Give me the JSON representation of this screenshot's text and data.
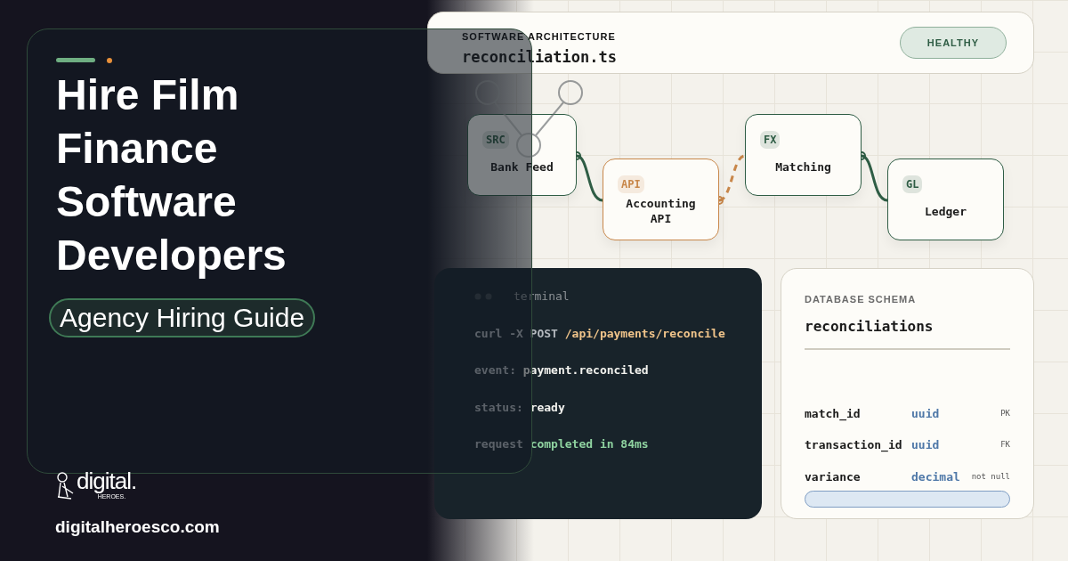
{
  "overlay": {
    "title_lines": [
      "Hire Film",
      "Finance",
      "Software",
      "Developers"
    ],
    "subtitle": "Agency Hiring Guide"
  },
  "brand": {
    "logo_word": "digital.",
    "logo_sub": "HEROES.",
    "url": "digitalheroesco.com"
  },
  "architecture": {
    "eyebrow": "SOFTWARE ARCHITECTURE",
    "file": "reconciliation.ts",
    "status": "HEALTHY"
  },
  "nodes": [
    {
      "badge": "SRC",
      "label": "Bank Feed",
      "color": "#2f5d45"
    },
    {
      "badge": "API",
      "label": "Accounting API",
      "color": "#c8874a"
    },
    {
      "badge": "FX",
      "label": "Matching",
      "color": "#2f5d45"
    },
    {
      "badge": "GL",
      "label": "Ledger",
      "color": "#2f5d45"
    }
  ],
  "links": [
    {
      "kind": "solid",
      "color": "#2f5d45"
    },
    {
      "kind": "dashed",
      "color": "#c8874a"
    },
    {
      "kind": "solid",
      "color": "#2f5d45"
    }
  ],
  "terminal": {
    "title": "terminal",
    "lines": [
      {
        "kind": "command",
        "prefix": "curl -X POST",
        "value": "/api/payments/reconcile"
      },
      {
        "kind": "field",
        "prefix": "event:",
        "value": "payment.reconciled"
      },
      {
        "kind": "field",
        "prefix": "status:",
        "value": "ready"
      },
      {
        "kind": "success",
        "prefix": "request",
        "value": "completed in 84ms"
      }
    ]
  },
  "schema": {
    "eyebrow": "DATABASE SCHEMA",
    "table": "reconciliations",
    "fields": [
      {
        "name": "match_id",
        "type": "uuid",
        "constraint": "PK"
      },
      {
        "name": "transaction_id",
        "type": "uuid",
        "constraint": "FK"
      },
      {
        "name": "variance",
        "type": "decimal",
        "constraint": "not null"
      }
    ]
  }
}
